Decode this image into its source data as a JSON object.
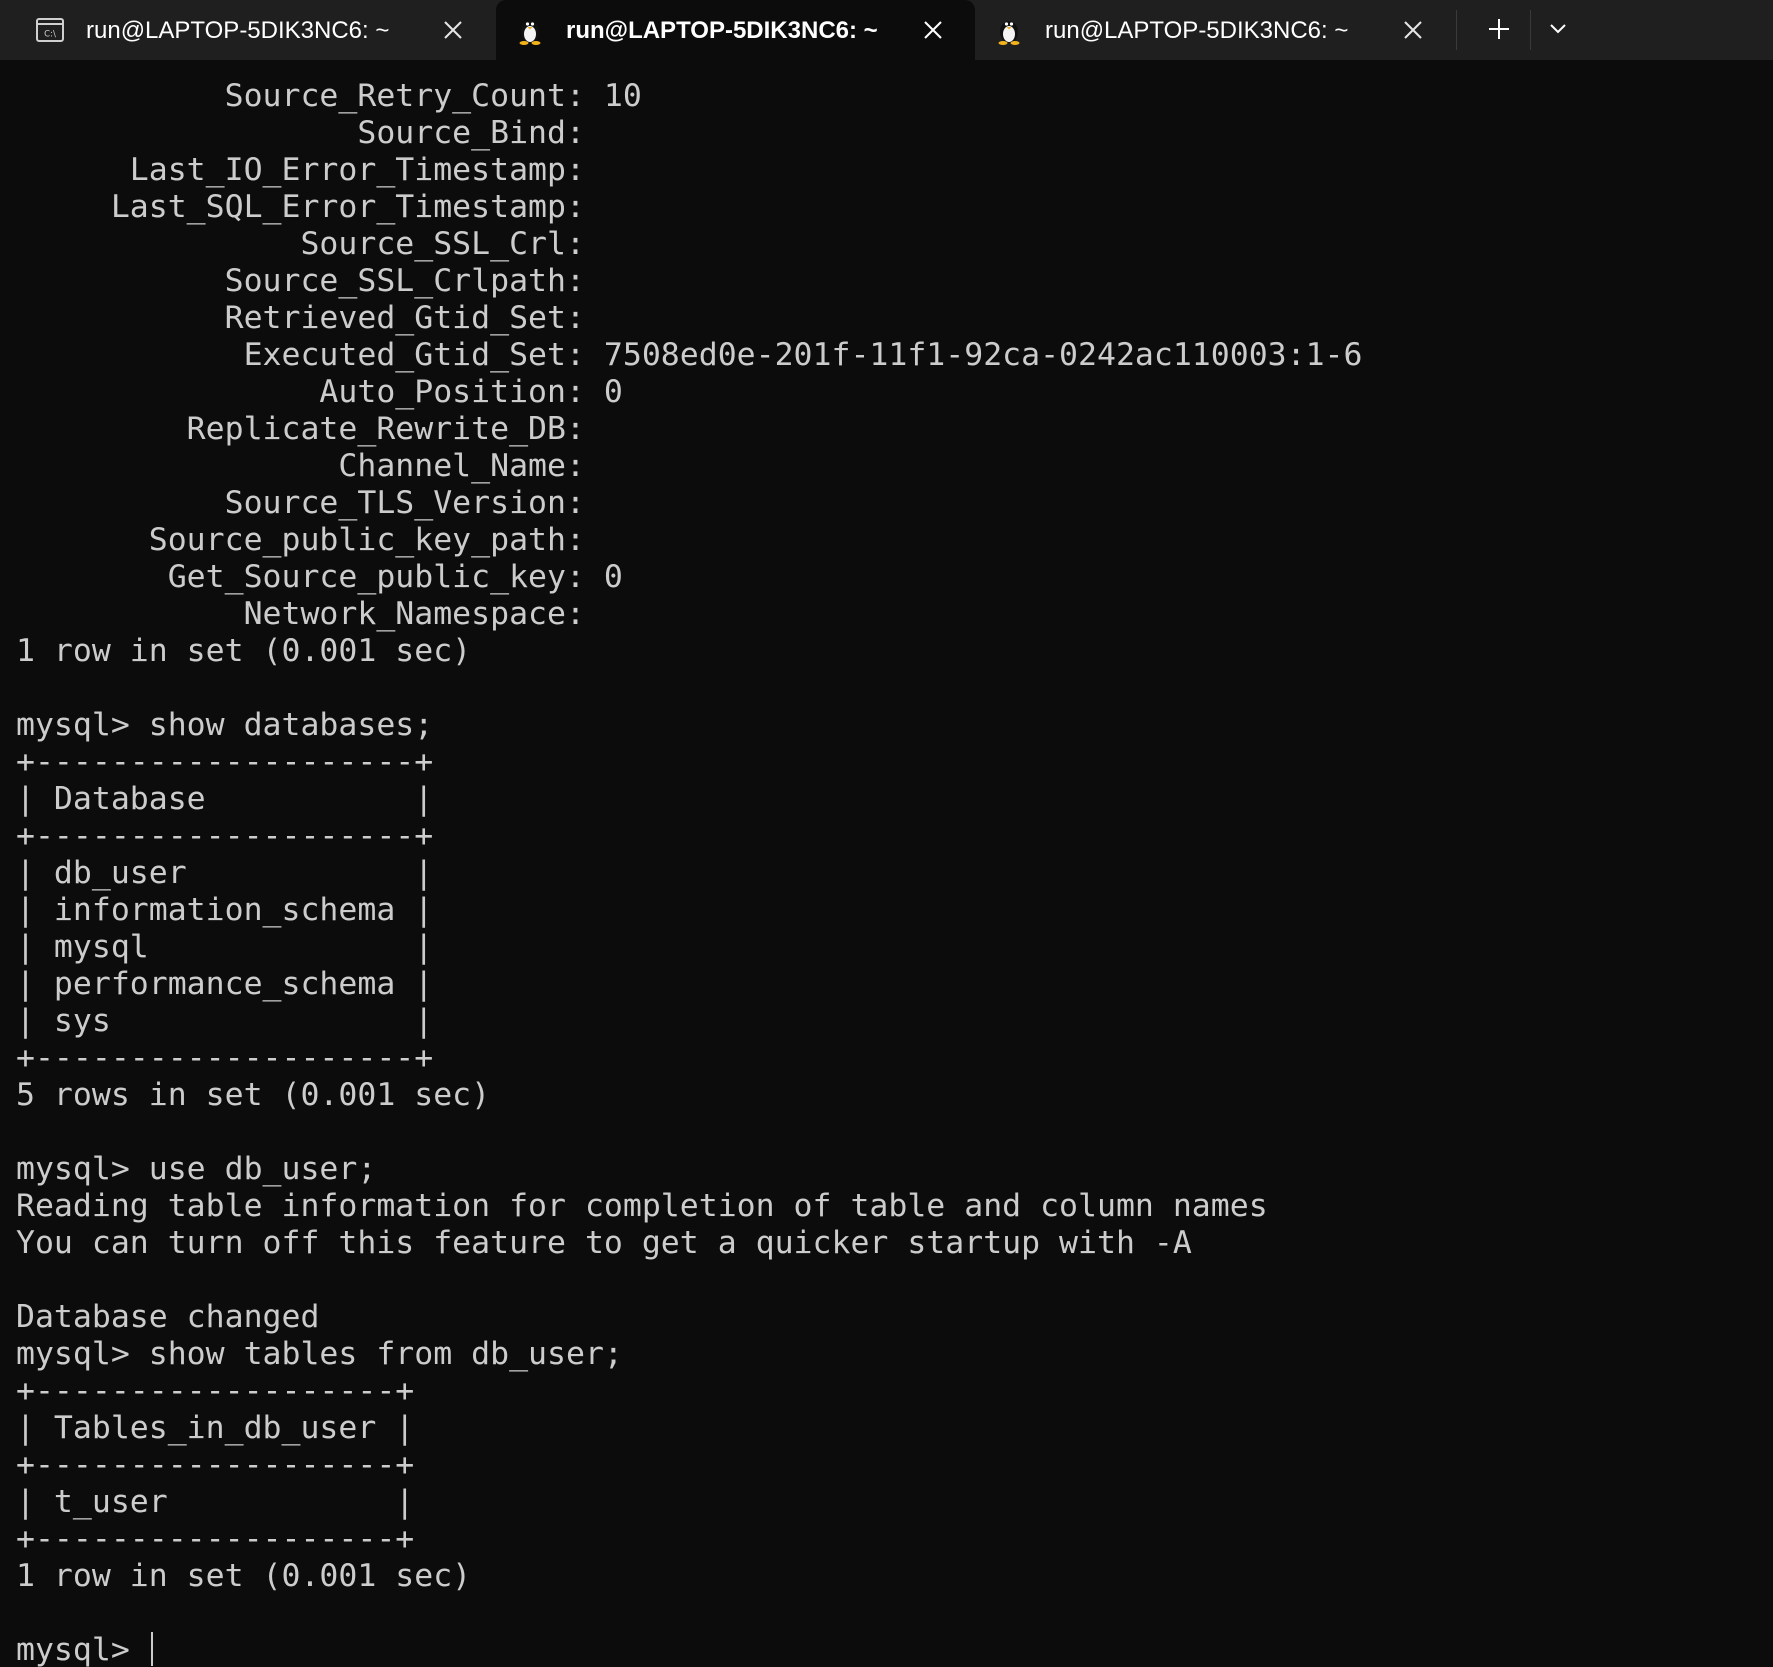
{
  "tabs": [
    {
      "label": "run@LAPTOP-5DIK3NC6: ~",
      "icon": "cmd-icon",
      "active": false
    },
    {
      "label": "run@LAPTOP-5DIK3NC6: ~",
      "icon": "linux-tux-icon",
      "active": true
    },
    {
      "label": "run@LAPTOP-5DIK3NC6: ~",
      "icon": "linux-tux-icon",
      "active": false
    }
  ],
  "tab_icon_cmd_text": "C:\\",
  "terminal": {
    "lines": [
      "           Source_Retry_Count: 10",
      "                  Source_Bind: ",
      "      Last_IO_Error_Timestamp: ",
      "     Last_SQL_Error_Timestamp: ",
      "               Source_SSL_Crl: ",
      "           Source_SSL_Crlpath: ",
      "           Retrieved_Gtid_Set: ",
      "            Executed_Gtid_Set: 7508ed0e-201f-11f1-92ca-0242ac110003:1-6",
      "                Auto_Position: 0",
      "         Replicate_Rewrite_DB: ",
      "                 Channel_Name: ",
      "           Source_TLS_Version: ",
      "       Source_public_key_path: ",
      "        Get_Source_public_key: 0",
      "            Network_Namespace: ",
      "1 row in set (0.001 sec)",
      "",
      "mysql> show databases;",
      "+--------------------+",
      "| Database           |",
      "+--------------------+",
      "| db_user            |",
      "| information_schema |",
      "| mysql              |",
      "| performance_schema |",
      "| sys                |",
      "+--------------------+",
      "5 rows in set (0.001 sec)",
      "",
      "mysql> use db_user;",
      "Reading table information for completion of table and column names",
      "You can turn off this feature to get a quicker startup with -A",
      "",
      "Database changed",
      "mysql> show tables from db_user;",
      "+-------------------+",
      "| Tables_in_db_user |",
      "+-------------------+",
      "| t_user            |",
      "+-------------------+",
      "1 row in set (0.001 sec)",
      "",
      "mysql> "
    ]
  },
  "colors": {
    "background": "#0c0c0c",
    "tabbar": "#1f1f1f",
    "foreground": "#cccccc"
  }
}
